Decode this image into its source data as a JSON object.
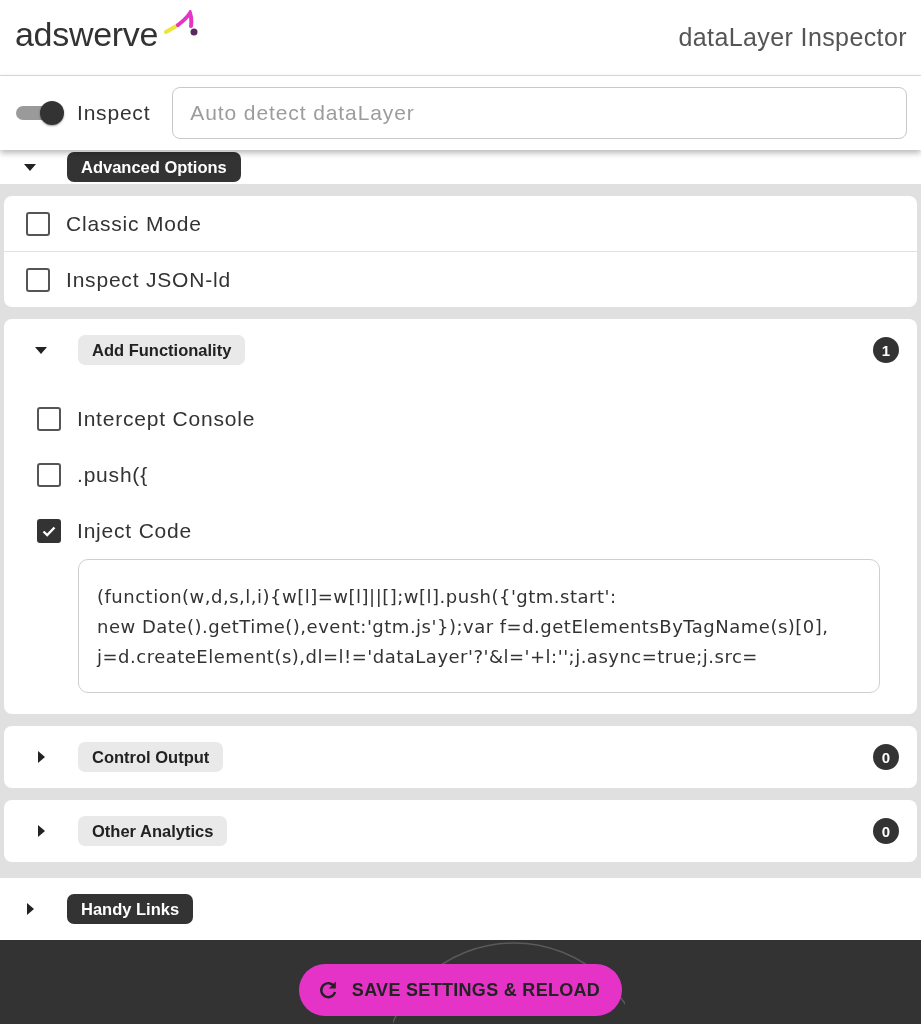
{
  "header": {
    "logo": "adswerve",
    "title": "dataLayer Inspector"
  },
  "toolbar": {
    "inspect": {
      "label": "Inspect",
      "on": true
    },
    "search": {
      "placeholder": "Auto detect dataLayer"
    }
  },
  "sections": [
    {
      "title": "Advanced Options",
      "expanded": true,
      "options": [
        {
          "label": "Classic Mode",
          "checked": false
        },
        {
          "label": "Inspect JSON-ld",
          "checked": false
        }
      ],
      "subsections": [
        {
          "title": "Add Functionality",
          "expanded": true,
          "count": "1",
          "options": [
            {
              "label": "Intercept Console",
              "checked": false
            },
            {
              "label": ".push({",
              "checked": false
            },
            {
              "label": "Inject Code",
              "checked": true,
              "code": "(function(w,d,s,l,i){w[l]=w[l]||[];w[l].push({'gtm.start':\nnew Date().getTime(),event:'gtm.js'});var f=d.getElementsByTagName(s)[0],\nj=d.createElement(s),dl=l!='dataLayer'?'&l='+l:'';j.async=true;j.src="
            }
          ]
        },
        {
          "title": "Control Output",
          "expanded": false,
          "count": "0"
        },
        {
          "title": "Other Analytics",
          "expanded": false,
          "count": "0"
        }
      ]
    },
    {
      "title": "Handy Links",
      "expanded": false
    }
  ],
  "footer": {
    "button": "SAVE SETTINGS & RELOAD"
  }
}
